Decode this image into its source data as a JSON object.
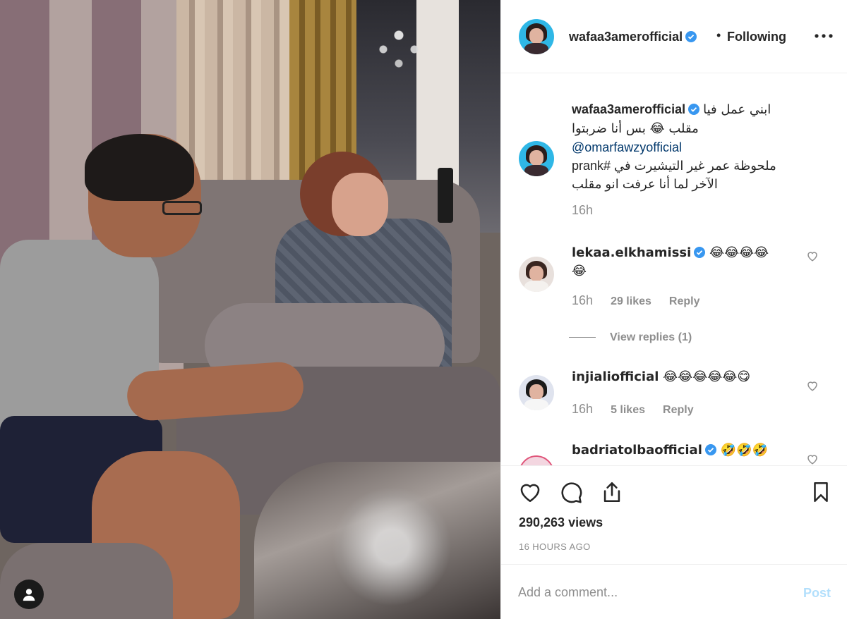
{
  "header": {
    "username": "wafaa3amerofficial",
    "separator": "•",
    "follow_status": "Following",
    "more_icon": "ellipsis-icon"
  },
  "caption": {
    "username": "wafaa3amerofficial",
    "line1": "ابني عمل فيا مقلب 😂 بس أنا ضربتوا",
    "mention": "@omarfawzyofficial",
    "line2": "ملحوظة عمر غير التيشيرت في #prank",
    "line3": "الآخر لما أنا عرفت انو مقلب",
    "time": "16h"
  },
  "comments": [
    {
      "username": "lekaa.elkhamissi",
      "text": "😂😂😂😂😂",
      "time": "16h",
      "likes": "29 likes",
      "reply_label": "Reply",
      "view_replies": "View replies (1)"
    },
    {
      "username": "injialiofficial",
      "text": "😂😂😂😂😂😋",
      "time": "16h",
      "likes": "5 likes",
      "reply_label": "Reply"
    },
    {
      "username": "badriatolbaofficial",
      "text": "🤣🤣🤣"
    }
  ],
  "actions": {
    "views": "290,263 views",
    "time_ago": "16 HOURS AGO"
  },
  "add_comment": {
    "placeholder": "Add a comment...",
    "post_label": "Post"
  },
  "colors": {
    "verified": "#3897f0",
    "mention": "#00376b",
    "muted": "#8e8e8e",
    "post_disabled": "#b2dffc"
  }
}
